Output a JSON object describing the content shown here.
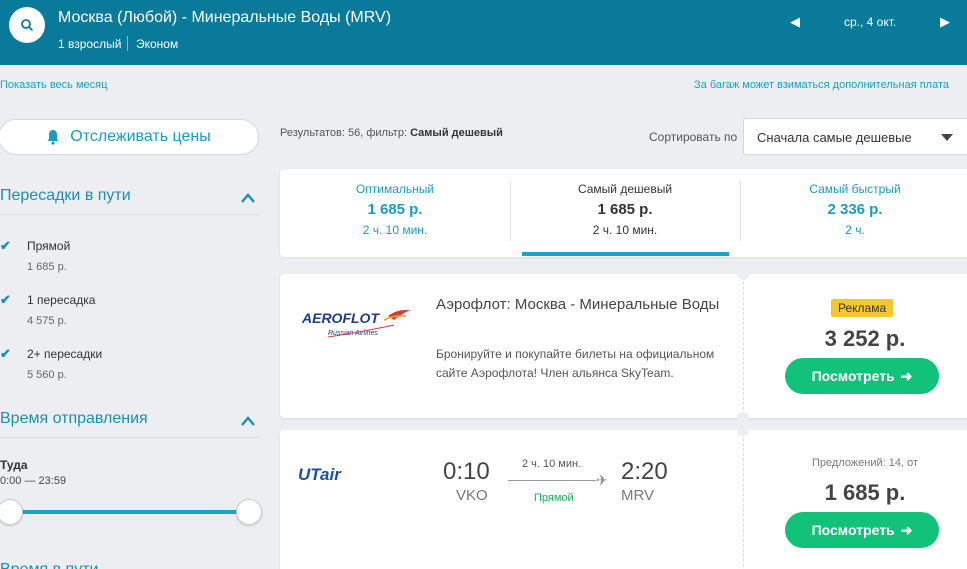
{
  "header": {
    "route": "Москва (Любой) - Минеральные Воды (MRV)",
    "passengers": "1 взрослый",
    "class": "Эконом",
    "date": "ср., 4 окт."
  },
  "links": {
    "show_month": "Показать весь месяц",
    "baggage_note": "За багаж может взиматься дополнительная плата"
  },
  "sidebar": {
    "track_prices": "Отслеживать цены",
    "stops_title": "Пересадки в пути",
    "stops": [
      {
        "label": "Прямой",
        "price": "1 685 р."
      },
      {
        "label": "1 пересадка",
        "price": "4 575 р."
      },
      {
        "label": "2+ пересадки",
        "price": "5 560 р."
      }
    ],
    "departure_title": "Время отправления",
    "departure_dir": "Туда",
    "departure_range": "0:00 — 23:59",
    "next_section": "Время в пути"
  },
  "results": {
    "count_prefix": "Результатов: 56, фильтр:",
    "filter": "Самый дешевый",
    "sort_label": "Сортировать по",
    "sort_value": "Сначала самые дешевые"
  },
  "tabs": [
    {
      "label": "Оптимальный",
      "price": "1 685 р.",
      "duration": "2 ч. 10 мин."
    },
    {
      "label": "Самый дешевый",
      "price": "1 685 р.",
      "duration": "2 ч. 10 мин."
    },
    {
      "label": "Самый быстрый",
      "price": "2 336 р.",
      "duration": "2 ч."
    }
  ],
  "ad": {
    "logo": "AEROFLOT",
    "logo_sub": "Russian Airlines",
    "title": "Аэрофлот: Москва - Минеральные Воды",
    "desc": "Бронируйте и покупайте билеты на официальном сайте Аэрофлота! Член альянса SkyTeam.",
    "badge": "Реклама",
    "price": "3 252 р.",
    "button": "Посмотреть"
  },
  "flight": {
    "airline": "UTair",
    "dep_time": "0:10",
    "dep_code": "VKO",
    "arr_time": "2:20",
    "arr_code": "MRV",
    "duration": "2 ч. 10 мин.",
    "stops": "Прямой",
    "offers": "Предложений: 14, от",
    "price": "1 685 р.",
    "button": "Посмотреть"
  },
  "colors": {
    "header_bg": "#0a7a9b",
    "accent": "#1aa3c8",
    "button_green": "#12c27a",
    "badge_yellow": "#f4c72a"
  }
}
